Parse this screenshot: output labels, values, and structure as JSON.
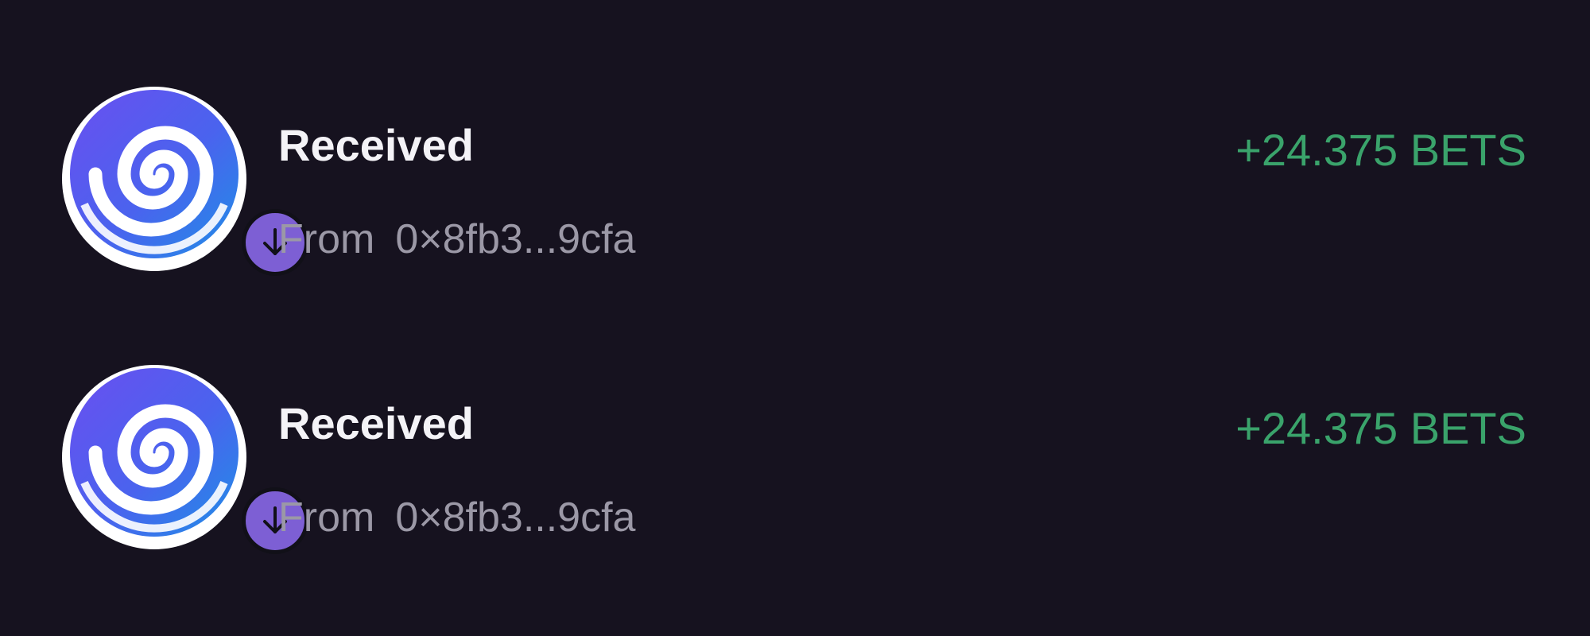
{
  "colors": {
    "background": "#16121f",
    "title": "#f4f3f7",
    "subtitle": "#9b98a6",
    "amount_positive": "#3aa36b",
    "badge": "#7d5fd4",
    "token_blue": "#4f5ce8"
  },
  "transactions": [
    {
      "title": "Received",
      "from_label": "From",
      "address": "0×8fb3...9cfa",
      "amount": "+24.375 BETS",
      "token_icon": "spiral-token-icon",
      "badge_icon": "arrow-down-icon"
    },
    {
      "title": "Received",
      "from_label": "From",
      "address": "0×8fb3...9cfa",
      "amount": "+24.375 BETS",
      "token_icon": "spiral-token-icon",
      "badge_icon": "arrow-down-icon"
    }
  ]
}
